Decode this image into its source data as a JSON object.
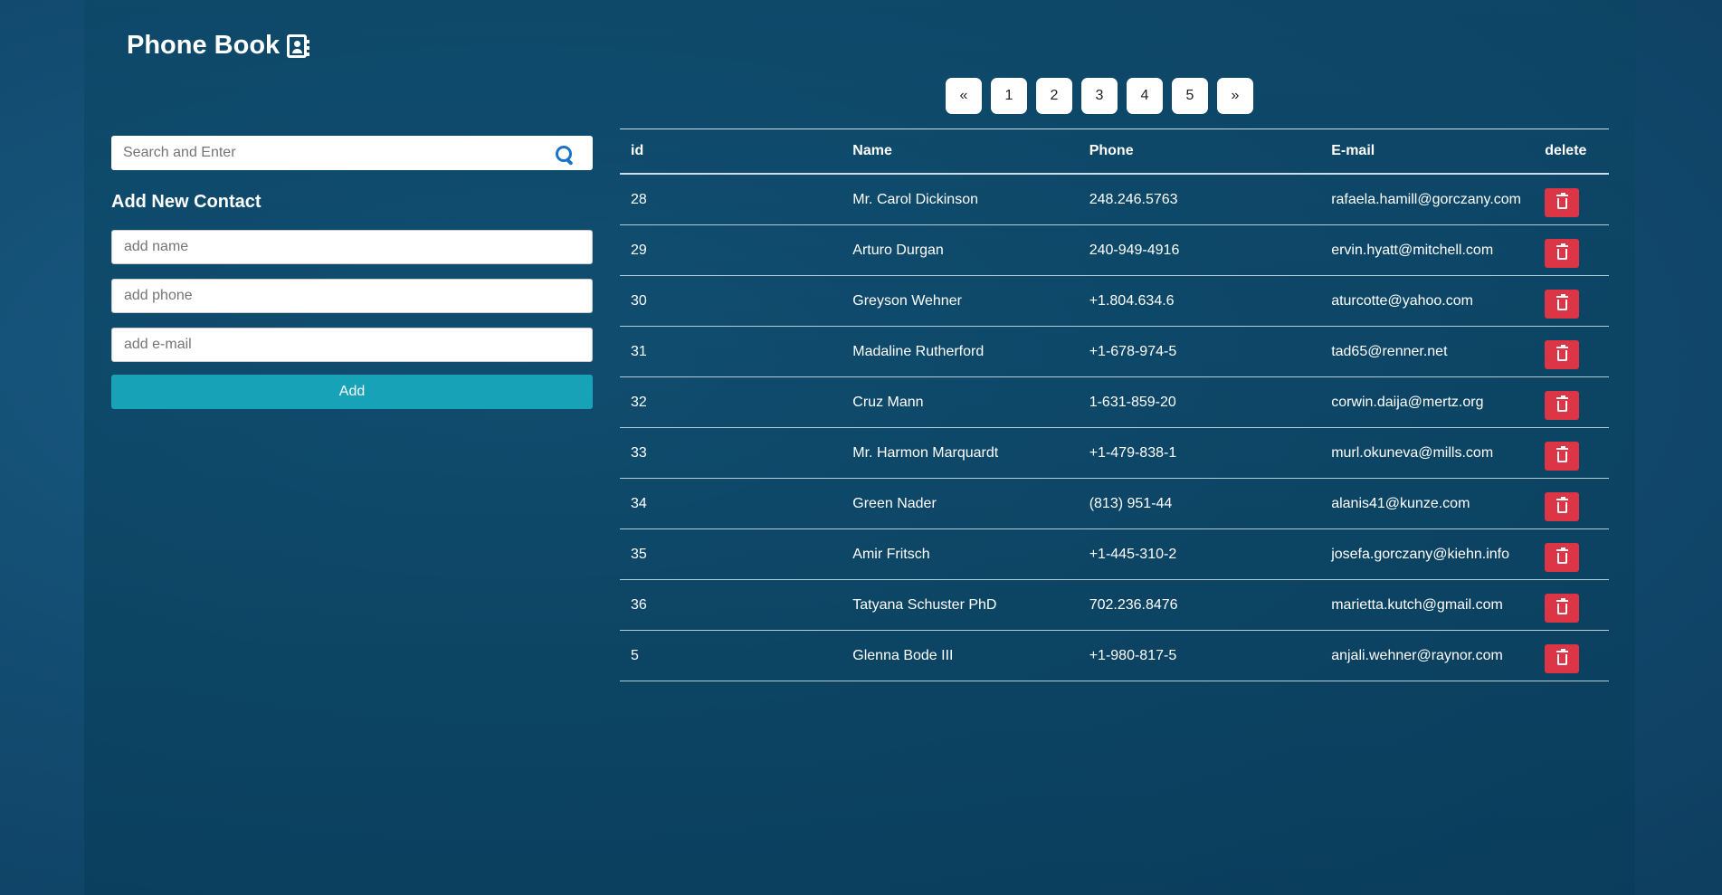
{
  "header": {
    "title": "Phone Book"
  },
  "search": {
    "placeholder": "Search and Enter"
  },
  "add_form": {
    "heading": "Add New Contact",
    "name_placeholder": "add name",
    "phone_placeholder": "add phone",
    "email_placeholder": "add e-mail",
    "add_label": "Add"
  },
  "pagination": {
    "prev": "«",
    "pages": [
      "1",
      "2",
      "3",
      "4",
      "5"
    ],
    "next": "»"
  },
  "table": {
    "headers": [
      "id",
      "Name",
      "Phone",
      "E-mail",
      "delete"
    ],
    "rows": [
      {
        "id": "28",
        "name": "Mr. Carol Dickinson",
        "phone": "248.246.5763",
        "email": "rafaela.hamill@gorczany.com"
      },
      {
        "id": "29",
        "name": "Arturo Durgan",
        "phone": "240-949-4916",
        "email": "ervin.hyatt@mitchell.com"
      },
      {
        "id": "30",
        "name": "Greyson Wehner",
        "phone": "+1.804.634.6",
        "email": "aturcotte@yahoo.com"
      },
      {
        "id": "31",
        "name": "Madaline Rutherford",
        "phone": "+1-678-974-5",
        "email": "tad65@renner.net"
      },
      {
        "id": "32",
        "name": "Cruz Mann",
        "phone": "1-631-859-20",
        "email": "corwin.daija@mertz.org"
      },
      {
        "id": "33",
        "name": "Mr. Harmon Marquardt",
        "phone": "+1-479-838-1",
        "email": "murl.okuneva@mills.com"
      },
      {
        "id": "34",
        "name": "Green Nader",
        "phone": "(813) 951-44",
        "email": "alanis41@kunze.com"
      },
      {
        "id": "35",
        "name": "Amir Fritsch",
        "phone": "+1-445-310-2",
        "email": "josefa.gorczany@kiehn.info"
      },
      {
        "id": "36",
        "name": "Tatyana Schuster PhD",
        "phone": "702.236.8476",
        "email": "marietta.kutch@gmail.com"
      },
      {
        "id": "5",
        "name": "Glenna Bode III",
        "phone": "+1-980-817-5",
        "email": "anjali.wehner@raynor.com"
      }
    ]
  },
  "colors": {
    "accent": "#17a2b8",
    "danger": "#dc3545",
    "search_icon": "#1a73c9"
  },
  "icons": {
    "title": "address-book-icon",
    "search": "search-icon",
    "delete": "trash-icon"
  }
}
